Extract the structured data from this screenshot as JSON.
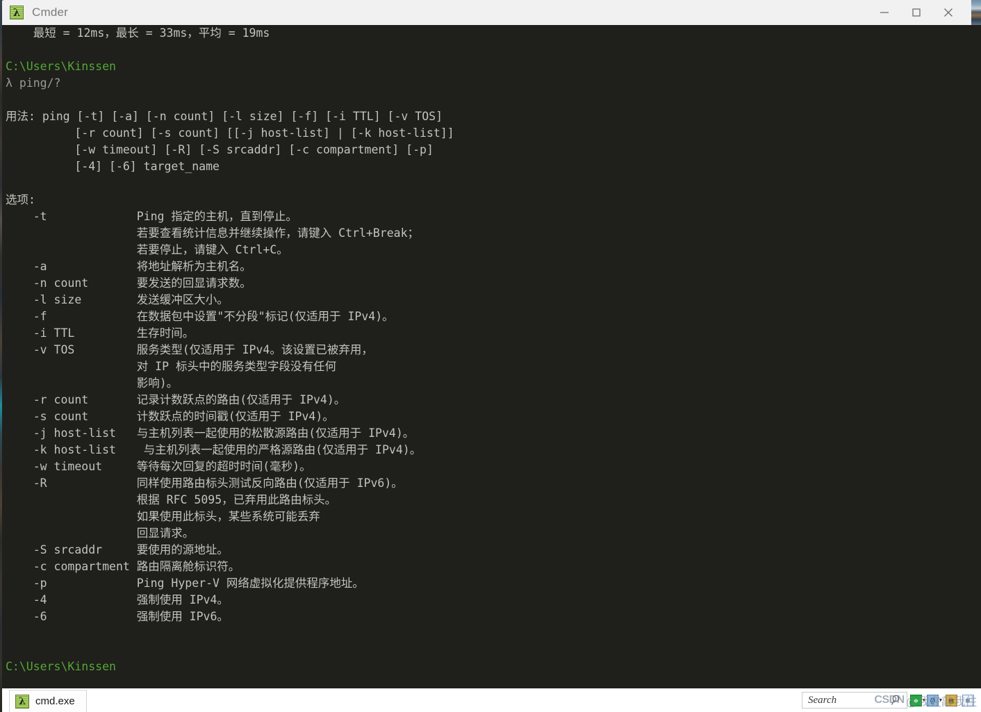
{
  "window": {
    "title": "Cmder",
    "icon": "lambda-icon",
    "controls": {
      "minimize": "minimize-button",
      "maximize": "maximize-button",
      "close": "close-button"
    }
  },
  "terminal": {
    "lines": [
      {
        "text": "    最短 = 12ms，最长 = 33ms，平均 = 19ms",
        "color": "fg"
      },
      {
        "text": "",
        "color": "fg"
      },
      {
        "text": "C:\\Users\\Kinssen",
        "color": "green"
      },
      {
        "text": "λ ping/?",
        "color": "dim"
      },
      {
        "text": "",
        "color": "fg"
      },
      {
        "text": "用法: ping [-t] [-a] [-n count] [-l size] [-f] [-i TTL] [-v TOS]",
        "color": "fg"
      },
      {
        "text": "          [-r count] [-s count] [[-j host-list] | [-k host-list]]",
        "color": "fg"
      },
      {
        "text": "          [-w timeout] [-R] [-S srcaddr] [-c compartment] [-p]",
        "color": "fg"
      },
      {
        "text": "          [-4] [-6] target_name",
        "color": "fg"
      },
      {
        "text": "",
        "color": "fg"
      },
      {
        "text": "选项:",
        "color": "fg"
      },
      {
        "text": "    -t             Ping 指定的主机，直到停止。",
        "color": "fg"
      },
      {
        "text": "                   若要查看统计信息并继续操作，请键入 Ctrl+Break；",
        "color": "fg"
      },
      {
        "text": "                   若要停止，请键入 Ctrl+C。",
        "color": "fg"
      },
      {
        "text": "    -a             将地址解析为主机名。",
        "color": "fg"
      },
      {
        "text": "    -n count       要发送的回显请求数。",
        "color": "fg"
      },
      {
        "text": "    -l size        发送缓冲区大小。",
        "color": "fg"
      },
      {
        "text": "    -f             在数据包中设置\"不分段\"标记(仅适用于 IPv4)。",
        "color": "fg"
      },
      {
        "text": "    -i TTL         生存时间。",
        "color": "fg"
      },
      {
        "text": "    -v TOS         服务类型(仅适用于 IPv4。该设置已被弃用，",
        "color": "fg"
      },
      {
        "text": "                   对 IP 标头中的服务类型字段没有任何",
        "color": "fg"
      },
      {
        "text": "                   影响)。",
        "color": "fg"
      },
      {
        "text": "    -r count       记录计数跃点的路由(仅适用于 IPv4)。",
        "color": "fg"
      },
      {
        "text": "    -s count       计数跃点的时间戳(仅适用于 IPv4)。",
        "color": "fg"
      },
      {
        "text": "    -j host-list   与主机列表一起使用的松散源路由(仅适用于 IPv4)。",
        "color": "fg"
      },
      {
        "text": "    -k host-list    与主机列表一起使用的严格源路由(仅适用于 IPv4)。",
        "color": "fg"
      },
      {
        "text": "    -w timeout     等待每次回复的超时时间(毫秒)。",
        "color": "fg"
      },
      {
        "text": "    -R             同样使用路由标头测试反向路由(仅适用于 IPv6)。",
        "color": "fg"
      },
      {
        "text": "                   根据 RFC 5095，已弃用此路由标头。",
        "color": "fg"
      },
      {
        "text": "                   如果使用此标头，某些系统可能丢弃",
        "color": "fg"
      },
      {
        "text": "                   回显请求。",
        "color": "fg"
      },
      {
        "text": "    -S srcaddr     要使用的源地址。",
        "color": "fg"
      },
      {
        "text": "    -c compartment 路由隔离舱标识符。",
        "color": "fg"
      },
      {
        "text": "    -p             Ping Hyper-V 网络虚拟化提供程序地址。",
        "color": "fg"
      },
      {
        "text": "    -4             强制使用 IPv4。",
        "color": "fg"
      },
      {
        "text": "    -6             强制使用 IPv6。",
        "color": "fg"
      },
      {
        "text": "",
        "color": "fg"
      },
      {
        "text": "",
        "color": "fg"
      },
      {
        "text": "C:\\Users\\Kinssen",
        "color": "green"
      }
    ]
  },
  "statusbar": {
    "tab": {
      "label": "cmd.exe",
      "icon": "lambda-icon"
    },
    "search": {
      "placeholder": "Search",
      "value": "",
      "icon": "search-icon"
    },
    "toolbar": [
      {
        "name": "new-console-button",
        "glyph": "❖",
        "style": "ic-green",
        "caret": true
      },
      {
        "name": "settings-button",
        "glyph": "@",
        "style": "ic-blue",
        "caret": true
      },
      {
        "name": "lock-button",
        "glyph": "▤",
        "style": "ic-gold",
        "caret": false
      },
      {
        "name": "tabs-list-button",
        "glyph": "≡",
        "style": "ic-list",
        "caret": false
      }
    ],
    "watermark": {
      "brand": "CSDN",
      "text": "@我在敲我住"
    }
  },
  "colors": {
    "terminal_bg": "#1f1f1b",
    "terminal_fg": "#c4c4bd",
    "prompt_green": "#54a738",
    "titlebar_bg": "#f1f1f1",
    "accent_lambda": "#8cba3f"
  }
}
